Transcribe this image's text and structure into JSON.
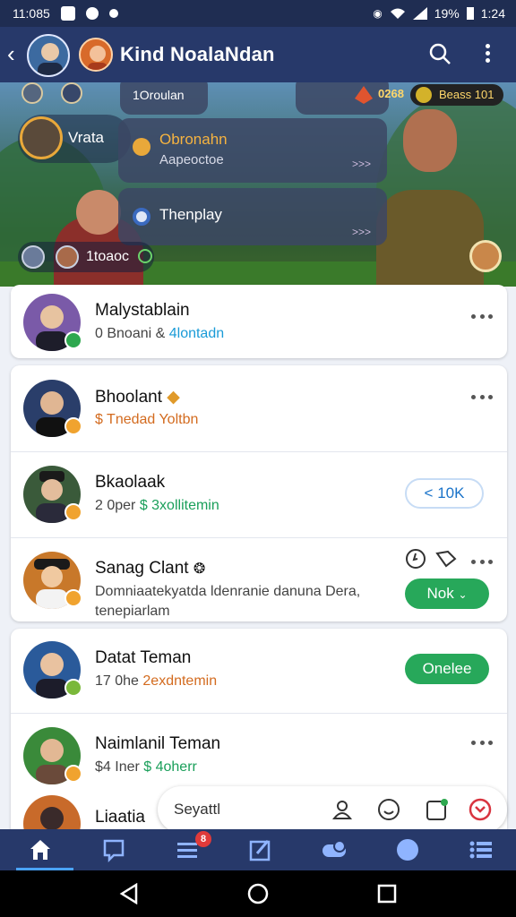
{
  "status_bar": {
    "time": "11:085",
    "battery": "19%",
    "clock": "1:24"
  },
  "app_bar": {
    "title": "Kind NoalaNdan"
  },
  "banner": {
    "top_pill": "1Oroulan",
    "score": "0268",
    "gold": "Beass 101",
    "leader_name": "Vrata",
    "card1": {
      "title": "Obronahn",
      "subtitle": "Aapeoctoe",
      "more": ">>>"
    },
    "card2": {
      "title": "Thenplay",
      "more": ">>>"
    },
    "footer_label": "1toaoc"
  },
  "contacts": [
    {
      "name": "Malystablain",
      "sub_a": "0 Bnoani & ",
      "sub_b": "4lontadn",
      "badge_color": "#2ea84f"
    },
    {
      "name": "Bhoolant",
      "sub_a": "$ Tnedad Yoltbn",
      "sub_b": "",
      "badge_color": "#f0a32f",
      "name_suffix": "◆"
    },
    {
      "name": "Bkaolaak",
      "sub_a": "2 0per ",
      "sub_b": "$ 3xollitemin",
      "badge_color": "#f0a32f",
      "action": "< 10K"
    },
    {
      "name": "Sanag Clant",
      "sub_a": "Domniaatekyatda ldenranie danuna Dera,",
      "sub_b": "tenepiarlam",
      "badge_color": "#f0a32f",
      "action": "Nok"
    },
    {
      "name": "Datat Teman",
      "sub_a": "17 0he ",
      "sub_b": "2exdntemin",
      "badge_color": "#7ab83a",
      "action": "Onelee"
    },
    {
      "name": "Naimlanil Teman",
      "sub_a": "$4 Iner ",
      "sub_b": "$ 4oherr",
      "badge_color": "#f0a32f"
    },
    {
      "name": "Liaatia"
    }
  ],
  "chat_input": {
    "placeholder": "Seyattl"
  },
  "bottom_nav": {
    "badge_count": "8"
  },
  "colors": {
    "primary": "#27396a",
    "accent_green": "#27a85a",
    "link_blue": "#1a9bd7"
  }
}
